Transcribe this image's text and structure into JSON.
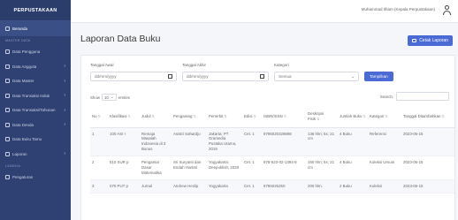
{
  "sidebar": {
    "brand": "PERPUSTAKAAN",
    "items_top": [
      {
        "label": "Beranda",
        "active": true
      }
    ],
    "section_master": "MASTER DATA",
    "items_master": [
      {
        "label": "Data Pengguna",
        "chev": ""
      },
      {
        "label": "Data Anggota",
        "chev": "›"
      },
      {
        "label": "Data Master",
        "chev": "›"
      },
      {
        "label": "Data Transaksi Induk",
        "chev": "›"
      },
      {
        "label": "Data Transaksi/Tahunan",
        "chev": "›"
      },
      {
        "label": "Data Denda",
        "chev": "›"
      },
      {
        "label": "Data Buku Tamu",
        "chev": ""
      },
      {
        "label": "Laporan",
        "chev": "›"
      }
    ],
    "section_other": "LAINNYA",
    "items_other": [
      {
        "label": "Pengaturan",
        "chev": ""
      }
    ]
  },
  "topbar": {
    "user": "Muhammad Ilham (Kepala Perpustakaan)"
  },
  "page": {
    "title": "Laporan Data Buku",
    "print_label": "Cetak Laporan"
  },
  "filters": {
    "start_label": "Tanggal Awal",
    "start_placeholder": "dd/mm/yyyy",
    "end_label": "Tanggal Akhir",
    "end_placeholder": "dd/mm/yyyy",
    "category_label": "Kategori",
    "category_value": "Semua",
    "apply_label": "Tampilkan"
  },
  "table_controls": {
    "show_label": "Show",
    "entries_value": "10",
    "entries_label": "entries",
    "search_label": "Search:"
  },
  "table": {
    "headers": [
      "No",
      "Klasifikasi",
      "Judul",
      "Pengarang",
      "Penerbit",
      "Edisi",
      "ISBN/ISSN",
      "Deskripsi Fisik",
      "Jumlah Buku",
      "Kategori",
      "Tanggal Ditambahkan"
    ],
    "rows": [
      [
        "1",
        "100 ASI r",
        "Remaja Masalah Indonesia di 3 Bunus",
        "Asistri Sahardjo",
        "Jakarta: PT Gramedia Pustaka Utama, 2019",
        "Cet. 1",
        "9786020329898",
        "136 hlm; 5x; 21 cm",
        "4 Buku",
        "Referensi",
        "2023-06-15"
      ],
      [
        "2",
        "510 SUR p",
        "Pengantar Dasar Matematika",
        "Sri Suryanti dan Endah Hartati",
        "Yogyakarta: Deepublish, 2020",
        "Cet. 1",
        "978-623-02-1394-8",
        "160 hlm; 5x; 21 cm",
        "4 Buku",
        "Koleksi Umum",
        "2023-06-15"
      ],
      [
        "3",
        "070 PUT p",
        "Jurnal",
        "Andrew Heslip",
        "Yogyakarta",
        "Cet. 1",
        "9786026260",
        "200 hlm.",
        "2 Buku",
        "Koleksi",
        "2023-06-15"
      ]
    ]
  }
}
